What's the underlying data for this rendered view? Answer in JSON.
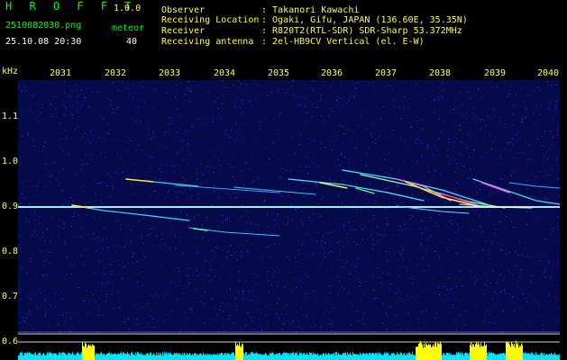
{
  "header": {
    "app_title": "H R O F F T",
    "version": "1.0.0",
    "filename": "2510082030.png",
    "datetime": "25.10.08 20:30",
    "count_label": "meteor",
    "count_value": "40",
    "info": [
      {
        "label": "Observer",
        "value": ": Takanori Kawachi"
      },
      {
        "label": "Receiving Location",
        "value": ": Ogaki, Gifu, JAPAN (136.60E, 35.35N)"
      },
      {
        "label": "Receiver",
        "value": ": R820T2(RTL-SDR) SDR-Sharp 53.372MHz"
      },
      {
        "label": "Receiving antenna",
        "value": ": 2el-HB9CV Vertical (el. E-W)"
      }
    ]
  },
  "axes": {
    "y_unit": "kHz",
    "y_ticks": [
      "1.1",
      "1.0",
      "0.9",
      "0.8",
      "0.7",
      "0.6"
    ],
    "x_ticks": [
      "2031",
      "2032",
      "2033",
      "2034",
      "2035",
      "2036",
      "2037",
      "2038",
      "2039",
      "2040"
    ]
  },
  "colors": {
    "background": "#000000",
    "spectrum": "#06094a",
    "header_green": "#00ff00",
    "header_yellow": "#ffff40",
    "level_cyan": "#00e5ff",
    "level_yellow": "#ffff00"
  }
}
